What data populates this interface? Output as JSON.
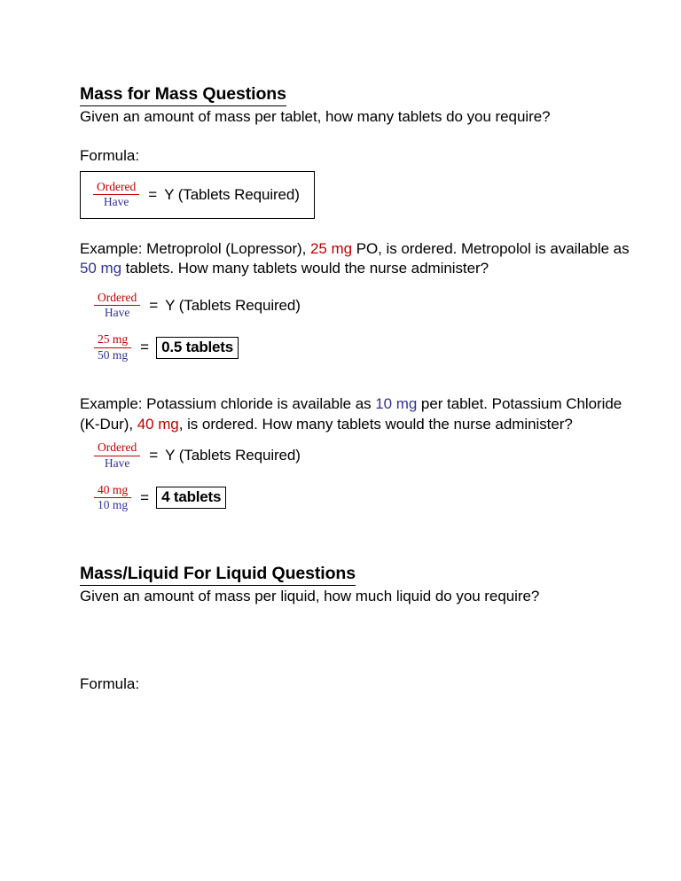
{
  "document": {
    "sections": [
      {
        "heading": "Mass for Mass Questions",
        "intro": "Given an amount of mass per tablet, how many tablets do you require?",
        "formula_label": "Formula:",
        "formula": {
          "numerator": "Ordered",
          "denominator": "Have",
          "equals": "=",
          "result": "Y (Tablets Required)"
        },
        "examples": [
          {
            "prefix": "Example: Metroprolol (Lopressor), ",
            "ordered_amount": "25 mg",
            "middle": " PO, is ordered. Metropolol is available as ",
            "have_amount": "50 mg",
            "suffix": " tablets. How many tablets would the nurse administer?",
            "generic_fraction": {
              "numerator": "Ordered",
              "denominator": "Have",
              "equals": "=",
              "result": "Y (Tablets Required)"
            },
            "worked_fraction": {
              "numerator": "25 mg",
              "denominator": "50 mg",
              "equals": "=",
              "answer": "0.5 tablets"
            }
          },
          {
            "prefix": "Example: Potassium chloride is available as ",
            "have_amount": "10 mg",
            "middle": " per tablet. Potassium Chloride (K-Dur), ",
            "ordered_amount": "40 mg",
            "suffix": ", is ordered. How many tablets would the nurse administer?",
            "generic_fraction": {
              "numerator": "Ordered",
              "denominator": "Have",
              "equals": "=",
              "result": "Y (Tablets Required)"
            },
            "worked_fraction": {
              "numerator": "40 mg",
              "denominator": "10 mg",
              "equals": "=",
              "answer": "4 tablets"
            }
          }
        ]
      },
      {
        "heading": "Mass/Liquid For Liquid Questions",
        "intro": "Given an amount of mass per liquid, how much liquid do you require?",
        "formula_label": "Formula:"
      }
    ]
  },
  "colors": {
    "ordered_red": "#c00000",
    "have_blue": "#333399",
    "text_black": "#000000",
    "page_background": "#ffffff"
  }
}
